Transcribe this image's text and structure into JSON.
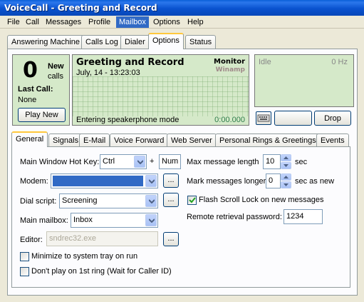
{
  "window": {
    "title": "VoiceCall - Greeting and Record"
  },
  "menu": [
    "File",
    "Call",
    "Messages",
    "Profile",
    "Mailbox",
    "Options",
    "Help"
  ],
  "main_tabs": [
    "Answering Machine",
    "Calls Log",
    "Dialer",
    "Options",
    "Status"
  ],
  "counter": {
    "count": "0",
    "new_label": "New",
    "calls_label": "calls",
    "last_call_label": "Last Call:",
    "last_call_value": "None",
    "play_new": "Play New"
  },
  "monitor": {
    "title": "Greeting and Record",
    "date": "July, 14 - 13:23:03",
    "monitor_label": "Monitor",
    "winamp_label": "Winamp",
    "status": "Entering speakerphone mode",
    "timer": "0:00.000"
  },
  "idle_panel": {
    "state": "Idle",
    "freq": "0 Hz"
  },
  "buttons": {
    "drop": "Drop"
  },
  "options_tabs": [
    "General",
    "Signals",
    "E-Mail",
    "Voice Forward",
    "Web Server",
    "Personal Rings & Greetings",
    "Events"
  ],
  "general": {
    "hotkey_label": "Main Window Hot Key:",
    "hotkey_value": "Ctrl",
    "plus": "+",
    "hotkey_key": "Num L",
    "modem_label": "Modem:",
    "modem_value": "",
    "dial_script_label": "Dial script:",
    "dial_script_value": "Screening",
    "mailbox_label": "Main mailbox:",
    "mailbox_value": "Inbox",
    "editor_label": "Editor:",
    "editor_value": "sndrec32.exe",
    "browse": "...",
    "minimize_tray": "Minimize to system tray on run",
    "dont_play_first": "Don't play on 1st ring (Wait for Caller ID)",
    "max_msg_label": "Max message length",
    "max_msg_value": "10",
    "max_msg_unit": "sec",
    "mark_longer_label": "Mark messages longer",
    "mark_longer_value": "0",
    "mark_longer_unit": "sec as new",
    "flash_scroll": "Flash Scroll Lock on new messages",
    "flash_scroll_checked": true,
    "remote_pw_label": "Remote retrieval password:",
    "remote_pw_value": "1234"
  },
  "colors": {
    "title_bar": "#0A5FD8",
    "panel_green": "#D5E9C9",
    "selection": "#316AC5"
  }
}
